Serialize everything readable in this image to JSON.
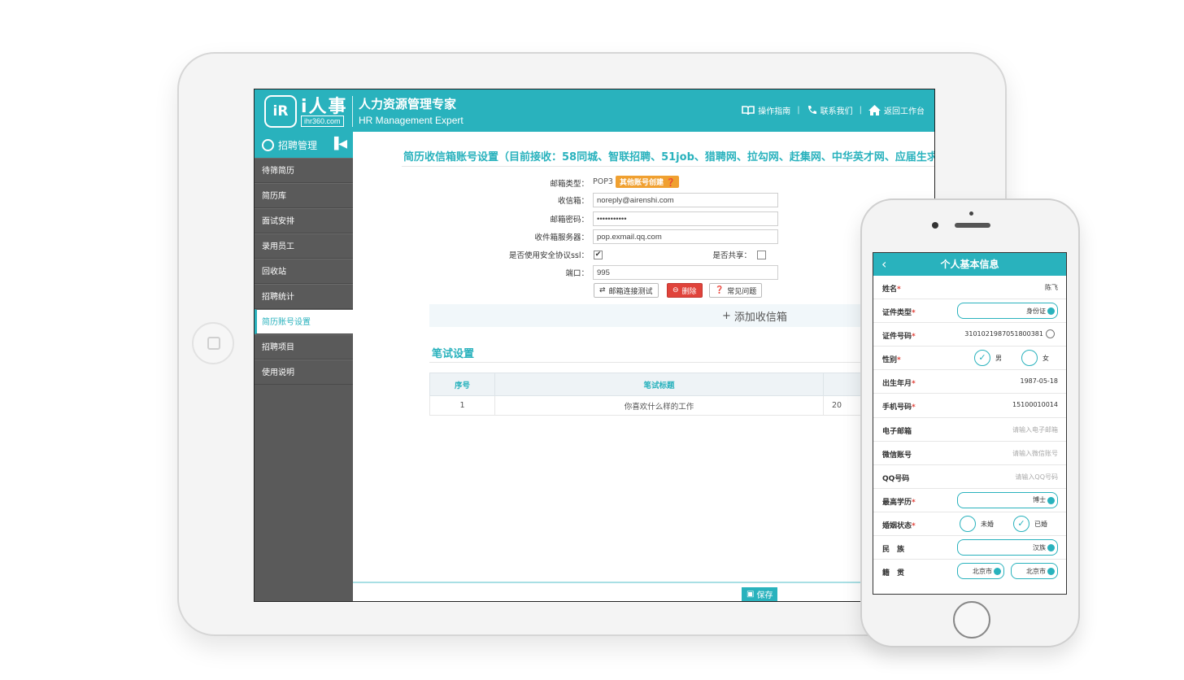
{
  "tablet": {
    "logo": {
      "badge": "iR",
      "cn": "i人事",
      "sub": "ihr360.com"
    },
    "brand": {
      "cn": "人力资源管理专家",
      "en": "HR Management Expert"
    },
    "header_nav": [
      "操作指南",
      "联系我们",
      "返回工作台"
    ],
    "sidebar": {
      "title": "招聘管理",
      "items": [
        "待筛简历",
        "简历库",
        "面试安排",
        "录用员工",
        "回收站",
        "招聘统计",
        "简历账号设置",
        "招聘项目",
        "使用说明"
      ],
      "active_index": 6
    },
    "page_title": "简历收信箱账号设置（目前接收：58同城、智联招聘、51job、猎聘网、拉勾网、赶集网、中华英才网、应届生求职网）",
    "form": {
      "mail_type_label": "邮箱类型：",
      "mail_type_value": "POP3",
      "other_account_tag": "其他账号创建",
      "inbox_label": "收信箱：",
      "inbox_value": "noreply@airenshi.com",
      "password_label": "邮箱密码：",
      "password_value": "•••••••••••",
      "server_label": "收件箱服务器：",
      "server_value": "pop.exmail.qq.com",
      "ssl_label": "是否使用安全协议ssl：",
      "ssl_checked": true,
      "share_label": "是否共享：",
      "share_checked": false,
      "port_label": "端口：",
      "port_value": "995",
      "btn_test": "邮箱连接测试",
      "btn_delete": "删除",
      "btn_faq": "常见问题"
    },
    "add_mailbox": "添加收信箱",
    "exam_section": {
      "title": "笔试设置",
      "columns": [
        "序号",
        "笔试标题",
        ""
      ],
      "rows": [
        [
          "1",
          "你喜欢什么样的工作",
          "20"
        ]
      ]
    },
    "save_label": "保存"
  },
  "phone": {
    "title": "个人基本信息",
    "rows": [
      {
        "label": "姓名",
        "required": true,
        "value": "陈飞"
      },
      {
        "label": "证件类型",
        "required": true,
        "select": "身份证"
      },
      {
        "label": "证件号码",
        "required": true,
        "value": "3101021987051800381"
      },
      {
        "label": "性别",
        "required": true,
        "options": [
          "男",
          "女"
        ],
        "selected": 0
      },
      {
        "label": "出生年月",
        "required": true,
        "value": "1987-05-18"
      },
      {
        "label": "手机号码",
        "required": true,
        "value": "15100010014"
      },
      {
        "label": "电子邮箱",
        "required": false,
        "placeholder": "请输入电子邮箱"
      },
      {
        "label": "微信账号",
        "required": false,
        "placeholder": "请输入微信账号"
      },
      {
        "label": "QQ号码",
        "required": false,
        "placeholder": "请输入QQ号码"
      },
      {
        "label": "最高学历",
        "required": true,
        "select": "博士"
      },
      {
        "label": "婚姻状态",
        "required": true,
        "options": [
          "未婚",
          "已婚"
        ],
        "selected": 1
      },
      {
        "label": "民　族",
        "required": false,
        "select": "汉族"
      },
      {
        "label": "籍　贯",
        "required": false,
        "selects": [
          "北京市",
          "北京市"
        ]
      }
    ]
  },
  "colors": {
    "accent": "#29b2bd",
    "danger": "#e0433b",
    "tag": "#f0a030",
    "sidebar": "#5a5a5a"
  }
}
